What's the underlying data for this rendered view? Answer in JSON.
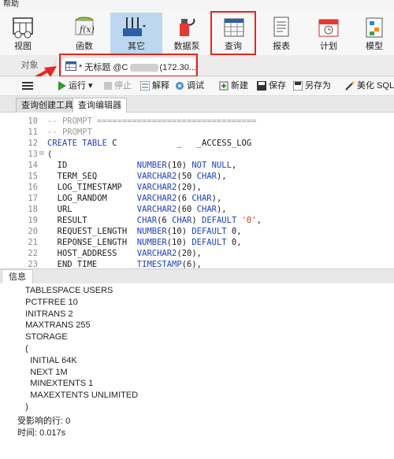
{
  "menu": {
    "help": "帮助"
  },
  "ribbon": {
    "items": [
      {
        "label": "视图",
        "icon": "view-icon"
      },
      {
        "label": "函数",
        "icon": "function-icon"
      },
      {
        "label": "其它",
        "icon": "tools-icon"
      },
      {
        "label": "数据泵",
        "icon": "datapump-icon"
      },
      {
        "label": "查询",
        "icon": "query-icon"
      },
      {
        "label": "报表",
        "icon": "report-icon"
      },
      {
        "label": "计划",
        "icon": "schedule-icon"
      },
      {
        "label": "模型",
        "icon": "model-icon"
      }
    ]
  },
  "tabs": {
    "objects": "对象",
    "query_tab": "* 无标题 @C",
    "query_tab_host": "(172.30...."
  },
  "toolbar": {
    "run": "运行",
    "stop": "停止",
    "explain": "解释",
    "debug": "调试",
    "new": "新建",
    "save": "保存",
    "save_as": "另存为",
    "beautify": "美化 SQL"
  },
  "subtabs": {
    "builder": "查询创建工具",
    "editor": "查询编辑器"
  },
  "editor": {
    "lines": [
      {
        "no": "10",
        "fold": "",
        "text": "-- PROMPT ================================"
      },
      {
        "no": "11",
        "fold": "",
        "text": "-- PROMPT"
      },
      {
        "no": "12",
        "fold": "",
        "text": "CREATE TABLE C            _   _ACCESS_LOG"
      },
      {
        "no": "13",
        "fold": "⊟",
        "text": "("
      },
      {
        "no": "14",
        "fold": "",
        "text": "  ID              NUMBER(10) NOT NULL,"
      },
      {
        "no": "15",
        "fold": "",
        "text": "  TERM_SEQ        VARCHAR2(50 CHAR),"
      },
      {
        "no": "16",
        "fold": "",
        "text": "  LOG_TIMESTAMP   VARCHAR2(20),"
      },
      {
        "no": "17",
        "fold": "",
        "text": "  LOG_RANDOM      VARCHAR2(6 CHAR),"
      },
      {
        "no": "18",
        "fold": "",
        "text": "  URL             VARCHAR2(60 CHAR),"
      },
      {
        "no": "19",
        "fold": "",
        "text": "  RESULT          CHAR(6 CHAR) DEFAULT '0',"
      },
      {
        "no": "20",
        "fold": "",
        "text": "  REQUEST_LENGTH  NUMBER(10) DEFAULT 0,"
      },
      {
        "no": "21",
        "fold": "",
        "text": "  REPONSE_LENGTH  NUMBER(10) DEFAULT 0,"
      },
      {
        "no": "22",
        "fold": "",
        "text": "  HOST_ADDRESS    VARCHAR2(20),"
      },
      {
        "no": "23",
        "fold": "",
        "text": "  END_TIME        TIMESTAMP(6),"
      }
    ]
  },
  "info": {
    "tab": "信息",
    "lines": [
      "  TABLESPACE USERS",
      "  PCTFREE 10",
      "  INITRANS 2",
      "  MAXTRANS 255",
      "  STORAGE",
      "  (",
      "    INITIAL 64K",
      "    NEXT 1M",
      "    MINEXTENTS 1",
      "    MAXEXTENTS UNLIMITED",
      "  )",
      "受影响的行: 0",
      "时间: 0.017s"
    ]
  },
  "colors": {
    "highlight_red": "#e8251f",
    "selected_ribbon": "#bcd7ef",
    "keyword_blue": "#1f3fbf",
    "string_red": "#d2361f"
  }
}
